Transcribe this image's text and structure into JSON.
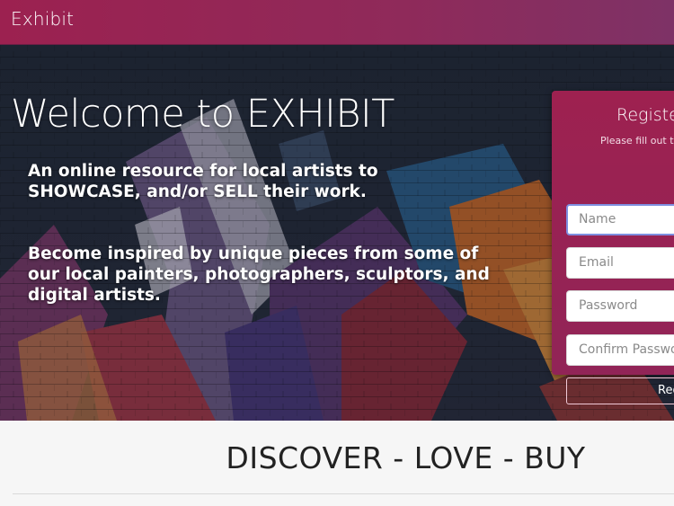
{
  "navbar": {
    "brand": "Exhibit"
  },
  "hero": {
    "title": "Welcome to EXHIBIT",
    "paragraph1": "An online resource for local artists to SHOWCASE, and/or SELL their work.",
    "paragraph2": "Become inspired by unique pieces from some of our local painters, photographers, sculptors, and digital artists."
  },
  "register": {
    "title": "Registe",
    "subtitle": "Please fill out thi",
    "name_placeholder": "Name",
    "email_placeholder": "Email",
    "password_placeholder": "Password",
    "confirm_placeholder": "Confirm Passwo",
    "button_label": "Reg"
  },
  "tagline": "DISCOVER - LOVE - BUY",
  "colors": {
    "brand": "#9c2150",
    "card": "#9e2150"
  }
}
